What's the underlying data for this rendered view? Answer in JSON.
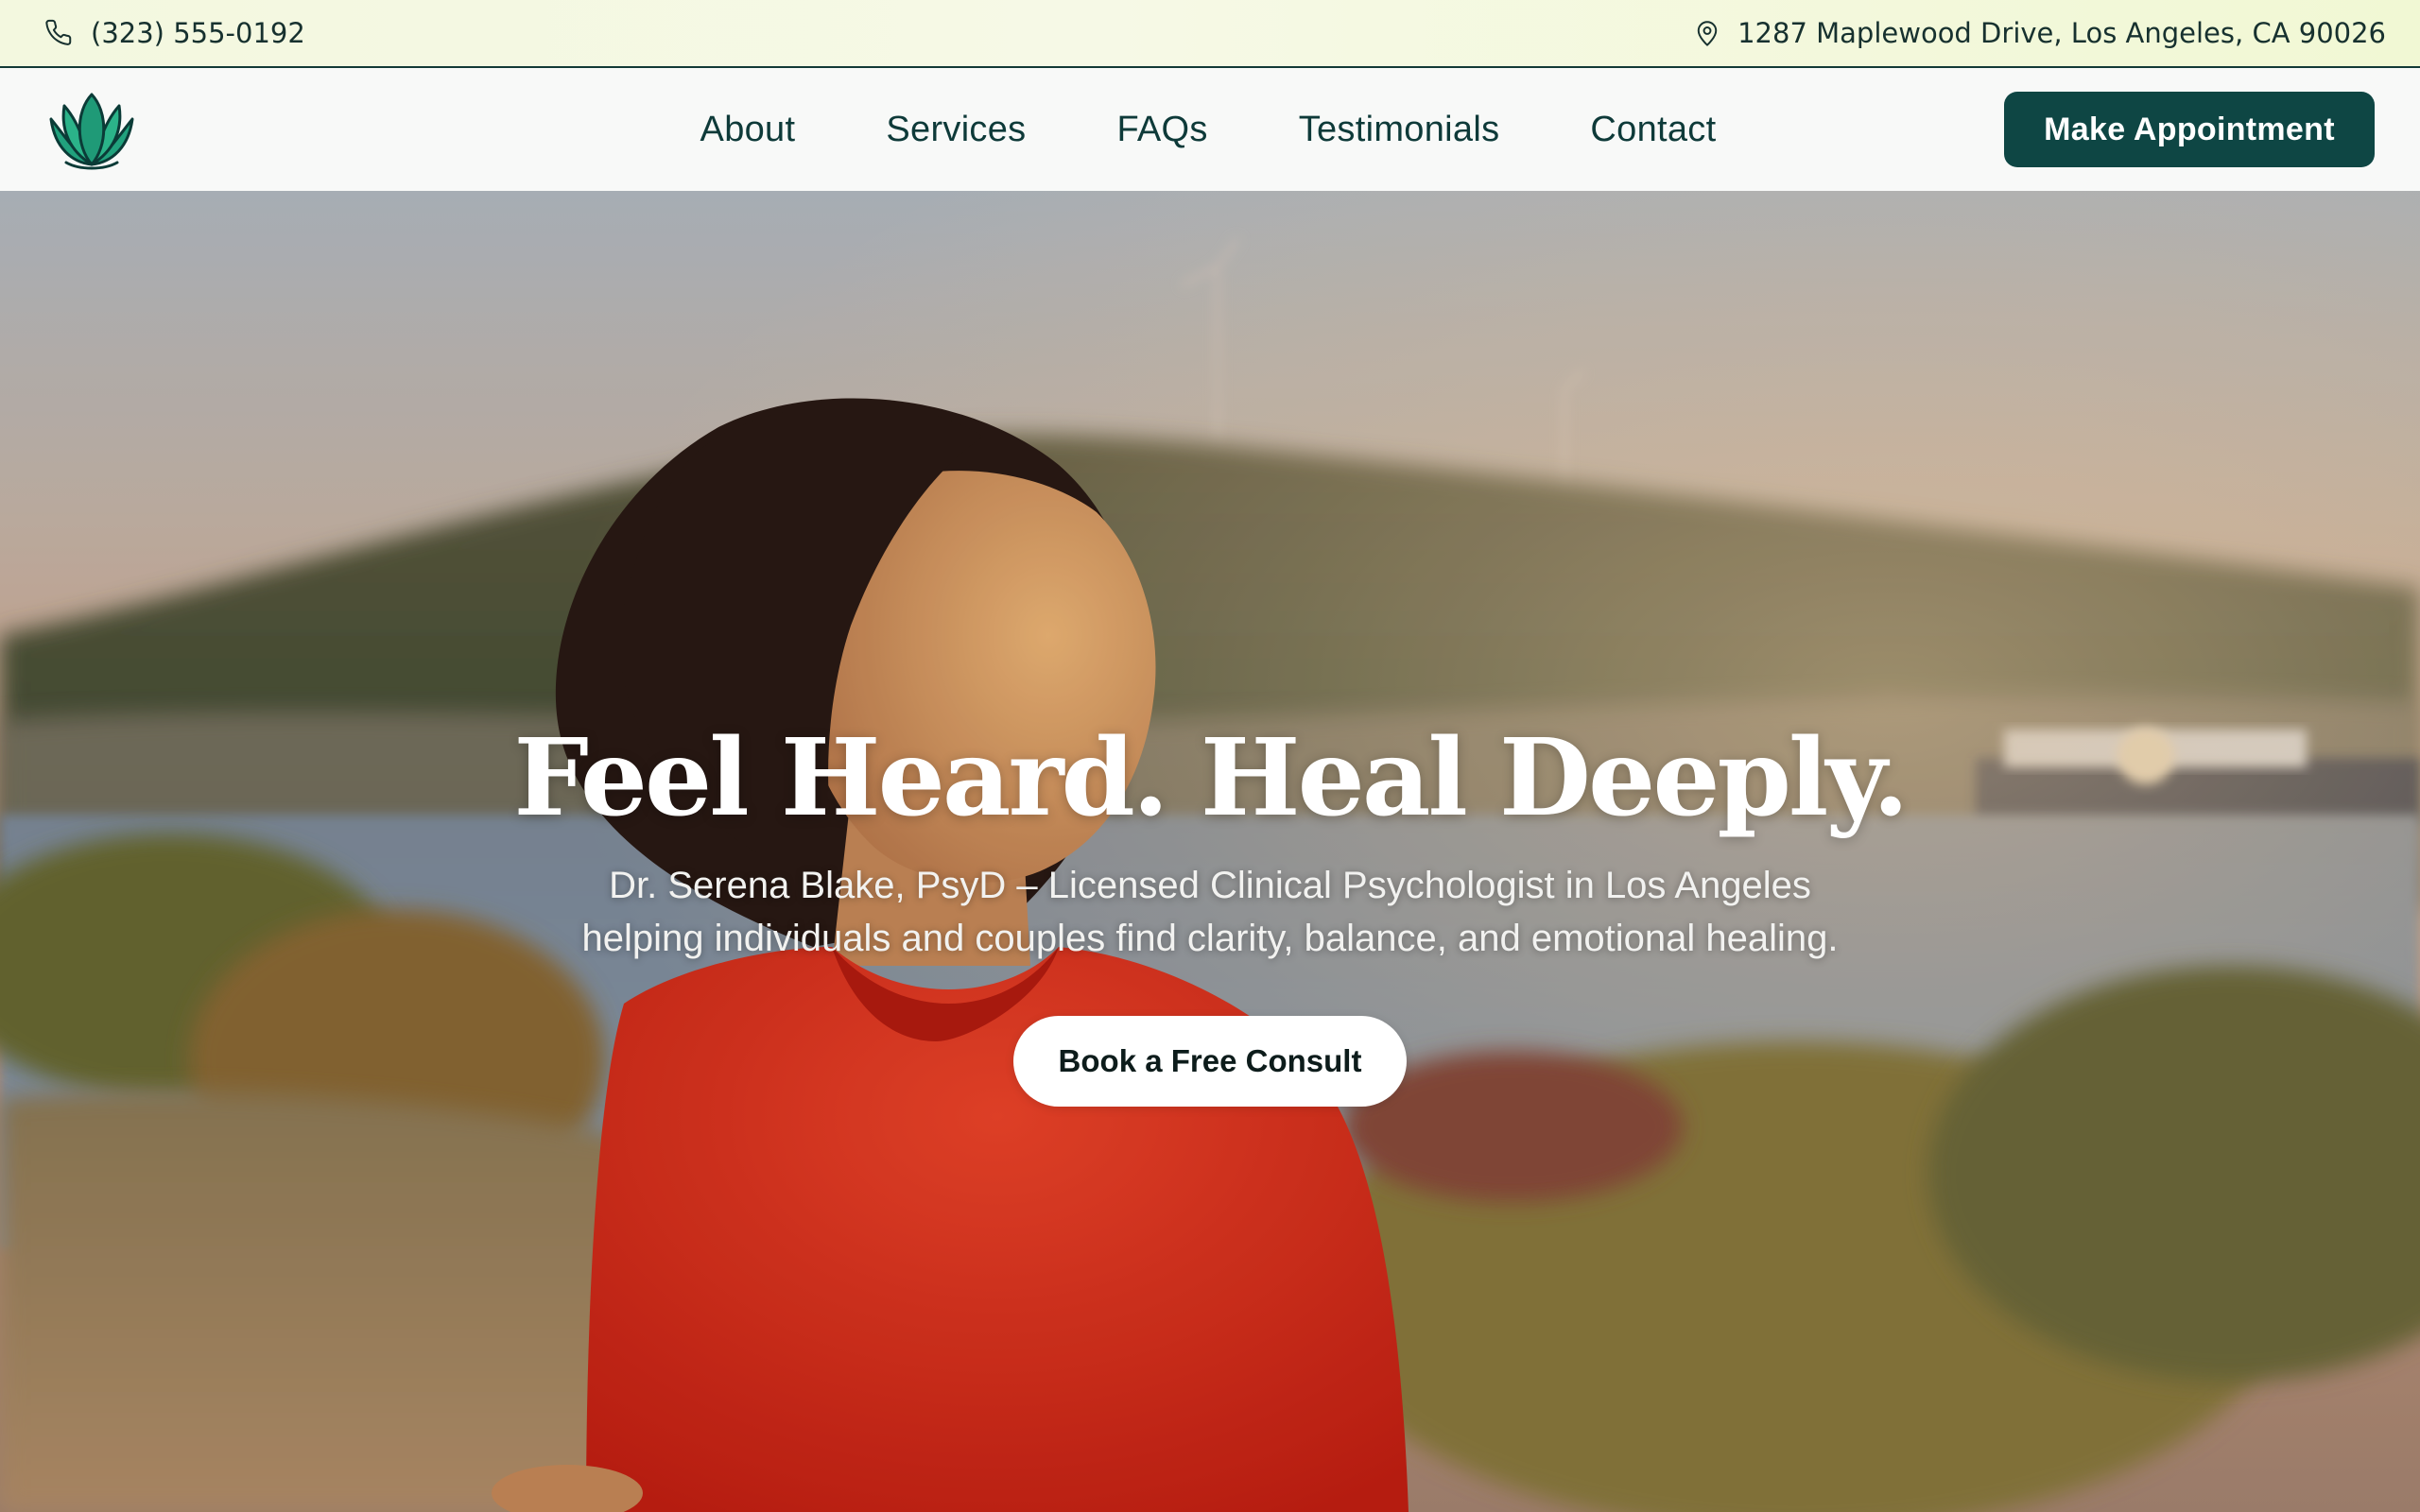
{
  "topbar": {
    "phone": "(323) 555-0192",
    "phone_icon": "phone-icon",
    "address": "1287 Maplewood Drive, Los Angeles, CA 90026",
    "address_icon": "map-pin-icon"
  },
  "navbar": {
    "logo_icon": "lotus-icon",
    "links": [
      {
        "label": "About"
      },
      {
        "label": "Services"
      },
      {
        "label": "FAQs"
      },
      {
        "label": "Testimonials"
      },
      {
        "label": "Contact"
      }
    ],
    "cta_label": "Make Appointment"
  },
  "hero": {
    "title": "Feel Heard. Heal Deeply.",
    "subtitle": "Dr. Serena Blake, PsyD – Licensed Clinical Psychologist in Los Angeles helping individuals and couples find clarity, balance, and emotional healing.",
    "cta_label": "Book a Free Consult"
  },
  "colors": {
    "brand_dark_teal": "#0e4644",
    "nav_text": "#0e3a39",
    "topbar_bg": "#f3f8df",
    "logo_green": "#1f9a77"
  }
}
